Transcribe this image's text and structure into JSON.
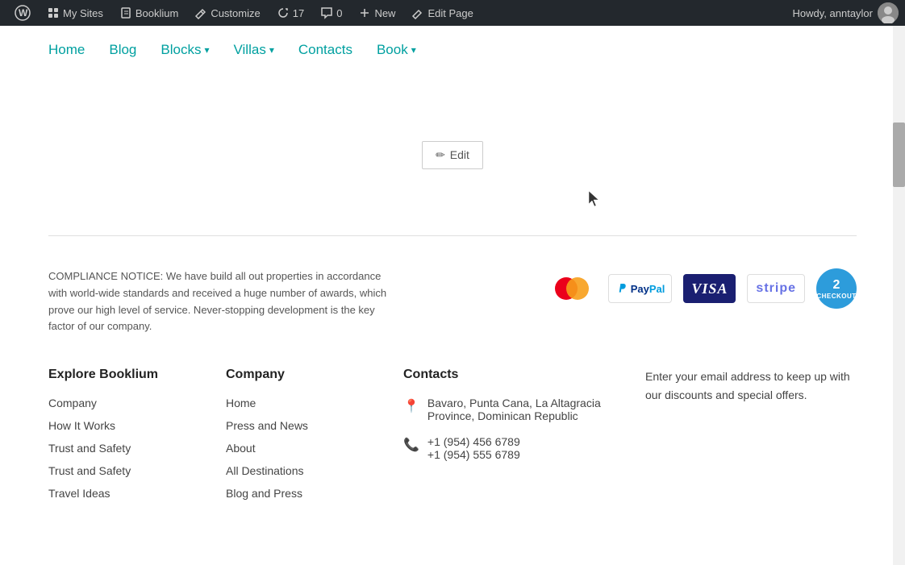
{
  "adminBar": {
    "wpIcon": "W",
    "items": [
      {
        "id": "my-sites",
        "icon": "home",
        "label": "My Sites"
      },
      {
        "id": "booklium",
        "icon": "book",
        "label": "Booklium"
      },
      {
        "id": "customize",
        "icon": "customize",
        "label": "Customize"
      },
      {
        "id": "updates",
        "icon": "update",
        "label": "17"
      },
      {
        "id": "comments",
        "icon": "comment",
        "label": "0"
      },
      {
        "id": "new",
        "icon": "plus",
        "label": "New"
      },
      {
        "id": "edit-page",
        "icon": "edit",
        "label": "Edit Page"
      }
    ],
    "user": {
      "greeting": "Howdy, anntaylor",
      "username": "anntaylor"
    }
  },
  "nav": {
    "links": [
      {
        "label": "Home",
        "hasDropdown": false
      },
      {
        "label": "Blog",
        "hasDropdown": false
      },
      {
        "label": "Blocks",
        "hasDropdown": true
      },
      {
        "label": "Villas",
        "hasDropdown": true
      },
      {
        "label": "Contacts",
        "hasDropdown": false
      },
      {
        "label": "Book",
        "hasDropdown": true
      }
    ]
  },
  "editButton": {
    "label": "Edit"
  },
  "footer": {
    "compliance": {
      "text": "COMPLIANCE NOTICE: We have build all out properties in accordance with world-wide standards and received a huge number of awards, which prove our high level of service. Never-stopping development is the key factor of our company."
    },
    "payment": {
      "methods": [
        "mastercard",
        "paypal",
        "visa",
        "stripe",
        "2checkout"
      ]
    },
    "columns": {
      "exploreBooklium": {
        "heading": "Explore Booklium",
        "links": [
          {
            "label": "Company"
          },
          {
            "label": "How It Works"
          },
          {
            "label": "Trust and Safety"
          },
          {
            "label": "Trust and Safety"
          },
          {
            "label": "Travel Ideas"
          }
        ]
      },
      "company": {
        "heading": "Company",
        "links": [
          {
            "label": "Home"
          },
          {
            "label": "Press and News"
          },
          {
            "label": "About"
          },
          {
            "label": "All Destinations"
          },
          {
            "label": "Blog and Press"
          }
        ]
      },
      "contacts": {
        "heading": "Contacts",
        "address": "Bavaro, Punta Cana, La Altagracia Province, Dominican Republic",
        "phones": [
          "+1 (954) 456 6789",
          "+1 (954) 555 6789"
        ]
      },
      "newsletter": {
        "text": "Enter your email address to keep up with our discounts and special offers."
      }
    }
  }
}
